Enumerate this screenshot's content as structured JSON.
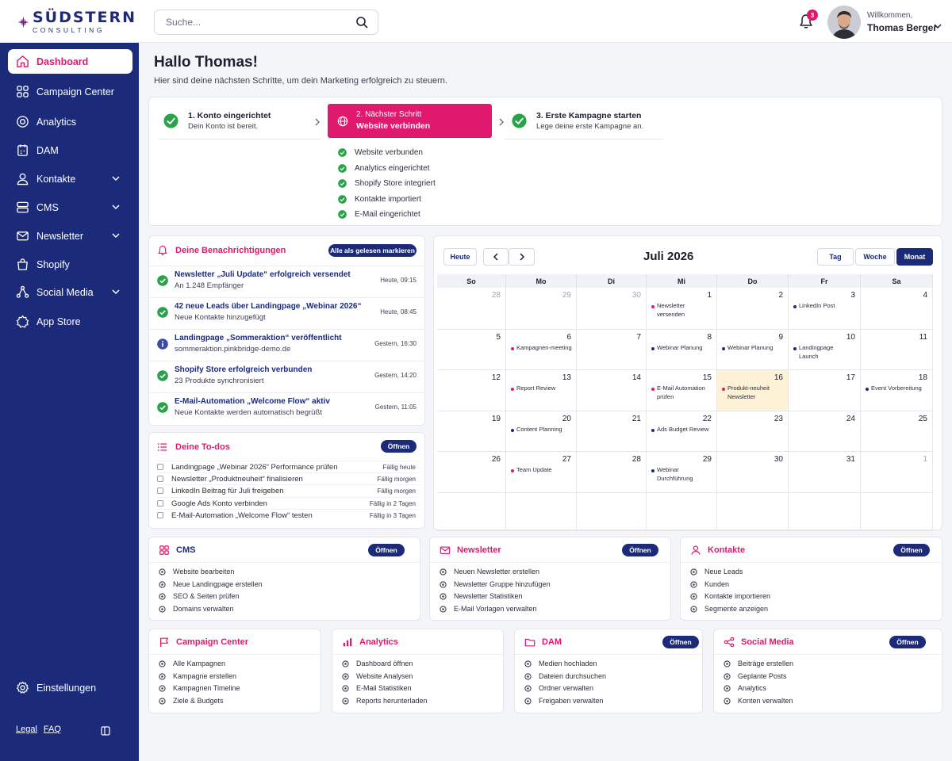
{
  "brand": {
    "name": "SÜDSTERN",
    "sub": "CONSULTING"
  },
  "search": {
    "placeholder": "Suche..."
  },
  "notifications_badge": "3",
  "user": {
    "greeting": "Willkommen,",
    "name": "Thomas Berger"
  },
  "colors": {
    "primary": "#1c2a7a",
    "accent": "#e0186e",
    "success": "#2aa24a",
    "today": "#fdf1d6"
  },
  "sidebar": {
    "items": [
      {
        "label": "Dashboard",
        "icon": "home-icon",
        "active": true
      },
      {
        "label": "Campaign Center",
        "icon": "grid-icon"
      },
      {
        "label": "Analytics",
        "icon": "target-icon"
      },
      {
        "label": "DAM",
        "icon": "calendar-icon"
      },
      {
        "label": "Kontakte",
        "icon": "user-icon",
        "expandable": true
      },
      {
        "label": "CMS",
        "icon": "server-icon",
        "expandable": true
      },
      {
        "label": "Newsletter",
        "icon": "mail-icon",
        "expandable": true
      },
      {
        "label": "Shopify",
        "icon": "bag-icon"
      },
      {
        "label": "Social Media",
        "icon": "share-icon",
        "expandable": true
      },
      {
        "label": "App Store",
        "icon": "puzzle-icon"
      }
    ],
    "settings": "Einstellungen",
    "footer": {
      "legal": "Legal",
      "faq": "FAQ"
    }
  },
  "header": {
    "title": "Hallo Thomas!",
    "subtitle": "Hier sind deine nächsten Schritte, um dein Marketing erfolgreich zu steuern."
  },
  "steps": [
    {
      "title": "1. Konto eingerichtet",
      "desc": "Dein Konto ist bereit.",
      "state": "done"
    },
    {
      "title": "2. Nächster Schritt",
      "desc": "Website verbinden",
      "state": "active"
    },
    {
      "title": "3. Erste Kampagne starten",
      "desc": "Lege deine erste Kampagne an.",
      "state": "done"
    }
  ],
  "checklist": [
    "Website verbunden",
    "Analytics eingerichtet",
    "Shopify Store integriert",
    "Kontakte importiert",
    "E-Mail eingerichtet"
  ],
  "notifications": {
    "title": "Deine Benachrichtigungen",
    "mark_all": "Alle als gelesen markieren",
    "items": [
      {
        "title": "Newsletter „Juli Update“ erfolgreich versendet",
        "desc": "An 1.248 Empfänger",
        "time": "Heute, 09:15",
        "type": "success"
      },
      {
        "title": "42 neue Leads über Landingpage „Webinar 2026“",
        "desc": "Neue Kontakte hinzugefügt",
        "time": "Heute, 08:45",
        "type": "success"
      },
      {
        "title": "Landingpage „Sommeraktion“ veröffentlicht",
        "desc": "sommeraktion.pinkbridge-demo.de",
        "time": "Gestern, 16:30",
        "type": "info"
      },
      {
        "title": "Shopify Store erfolgreich verbunden",
        "desc": "23 Produkte synchronisiert",
        "time": "Gestern, 14:20",
        "type": "success"
      },
      {
        "title": "E-Mail-Automation „Welcome Flow“ aktiv",
        "desc": "Neue Kontakte werden automatisch begrüßt",
        "time": "Gestern, 11:05",
        "type": "success"
      }
    ]
  },
  "todos": {
    "title": "Deine To-dos",
    "open": "Öffnen",
    "items": [
      {
        "label": "Landingpage „Webinar 2026“ Performance prüfen",
        "due": "Fällig heute"
      },
      {
        "label": "Newsletter „Produktneuheit“ finalisieren",
        "due": "Fällig morgen"
      },
      {
        "label": "LinkedIn Beitrag für Juli freigeben",
        "due": "Fällig morgen"
      },
      {
        "label": "Google Ads Konto verbinden",
        "due": "Fällig in 2 Tagen"
      },
      {
        "label": "E-Mail-Automation „Welcome Flow“ testen",
        "due": "Fällig in 3 Tagen"
      }
    ]
  },
  "calendar": {
    "today_btn": "Heute",
    "title": "Juli 2026",
    "views": [
      "Tag",
      "Woche",
      "Monat"
    ],
    "selected_view": "Monat",
    "weekdays": [
      "So",
      "Mo",
      "Di",
      "Mi",
      "Do",
      "Fr",
      "Sa"
    ],
    "weeks": [
      [
        {
          "d": "28",
          "m": true
        },
        {
          "d": "29",
          "m": true
        },
        {
          "d": "30",
          "m": true
        },
        {
          "d": "1",
          "ev": "Newsletter versenden",
          "c": "pink"
        },
        {
          "d": "2"
        },
        {
          "d": "3",
          "ev": "LinkedIn Post",
          "c": "navy"
        },
        {
          "d": "4"
        }
      ],
      [
        {
          "d": "5"
        },
        {
          "d": "6",
          "ev": "Kampagnen-meeting",
          "c": "pink"
        },
        {
          "d": "7"
        },
        {
          "d": "8",
          "ev": "Webinar Planung",
          "c": "navy"
        },
        {
          "d": "9",
          "ev": "Webinar Planung",
          "c": "navy"
        },
        {
          "d": "10",
          "ev": "Landingpage Launch",
          "c": "navy"
        },
        {
          "d": "11"
        }
      ],
      [
        {
          "d": "12"
        },
        {
          "d": "13",
          "ev": "Report Review",
          "c": "pink"
        },
        {
          "d": "14"
        },
        {
          "d": "15",
          "ev": "E-Mail Automation prüfen",
          "c": "pink"
        },
        {
          "d": "16",
          "ev": "Produkt-neuheit Newsletter",
          "c": "pink",
          "today": true
        },
        {
          "d": "17"
        },
        {
          "d": "18",
          "ev": "Event Vorbereitung",
          "c": "navy"
        }
      ],
      [
        {
          "d": "19"
        },
        {
          "d": "20",
          "ev": "Content Planning",
          "c": "navy"
        },
        {
          "d": "21"
        },
        {
          "d": "22",
          "ev": "Ads Budget Review",
          "c": "navy"
        },
        {
          "d": "23"
        },
        {
          "d": "24"
        },
        {
          "d": "25"
        }
      ],
      [
        {
          "d": "26"
        },
        {
          "d": "27",
          "ev": "Team Update",
          "c": "pink"
        },
        {
          "d": "28"
        },
        {
          "d": "29",
          "ev": "Webinar Durchführung",
          "c": "navy"
        },
        {
          "d": "30"
        },
        {
          "d": "31"
        },
        {
          "d": "1",
          "m": true
        }
      ],
      [
        {
          "d": ""
        },
        {
          "d": ""
        },
        {
          "d": ""
        },
        {
          "d": ""
        },
        {
          "d": ""
        },
        {
          "d": ""
        },
        {
          "d": ""
        }
      ]
    ]
  },
  "modules": [
    {
      "title": "CMS",
      "icon": "grid-icon",
      "button": "Öffnen",
      "navy": true,
      "items": [
        "Website bearbeiten",
        "Neue Landingpage erstellen",
        "SEO & Seiten prüfen",
        "Domains verwalten"
      ]
    },
    {
      "title": "Newsletter",
      "icon": "mail-icon",
      "button": "Öffnen",
      "items": [
        "Neuen Newsletter erstellen",
        "Newsletter Gruppe hinzufügen",
        "Newsletter Statistiken",
        "E-Mail Vorlagen verwalten"
      ]
    },
    {
      "title": "Kontakte",
      "icon": "user-icon",
      "button": "Öffnen",
      "items": [
        "Neue Leads",
        "Kunden",
        "Kontakte importieren",
        "Segmente anzeigen"
      ]
    },
    {
      "title": "Campaign Center",
      "icon": "flag-icon",
      "items": [
        "Alle Kampagnen",
        "Kampagne erstellen",
        "Kampagnen Timeline",
        "Ziele & Budgets"
      ]
    },
    {
      "title": "Analytics",
      "icon": "bar-chart-icon",
      "items": [
        "Dashboard öffnen",
        "Website Analysen",
        "E-Mail Statistiken",
        "Reports herunterladen"
      ]
    },
    {
      "title": "DAM",
      "icon": "folder-icon",
      "button": "Öffnen",
      "items": [
        "Medien hochladen",
        "Dateien durchsuchen",
        "Ordner verwalten",
        "Freigaben verwalten"
      ]
    },
    {
      "title": "Social Media",
      "icon": "share-icon",
      "button": "Öffnen",
      "items": [
        "Beiträge erstellen",
        "Geplante Posts",
        "Analytics",
        "Konten verwalten"
      ]
    }
  ]
}
